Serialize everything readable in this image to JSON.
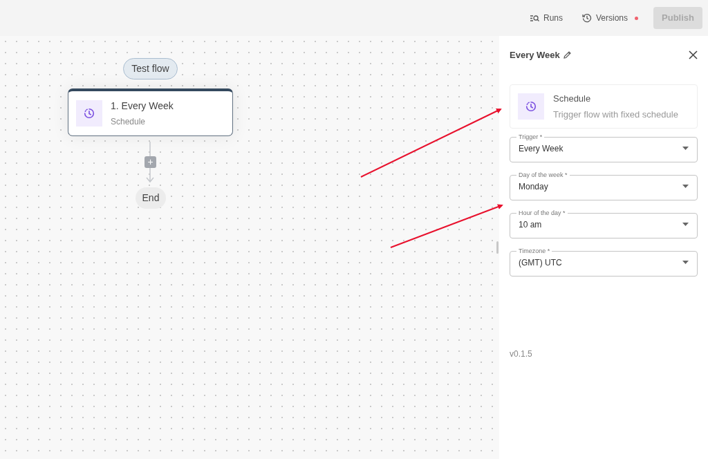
{
  "toolbar": {
    "runs": "Runs",
    "versions": "Versions",
    "versions_changed": true,
    "publish": {
      "label": "Publish",
      "disabled": true
    }
  },
  "canvas": {
    "test_button": "Test flow",
    "steps": [
      {
        "title": "1. Every Week",
        "subtitle": "Schedule"
      }
    ],
    "add_button": "+",
    "end": "End"
  },
  "panel": {
    "title": "Every Week",
    "trigger_card": {
      "title": "Schedule",
      "description": "Trigger flow with fixed schedule"
    },
    "fields": [
      {
        "label": "Trigger *",
        "value": "Every Week"
      },
      {
        "label": "Day of the week *",
        "value": "Monday"
      },
      {
        "label": "Hour of the day *",
        "value": "10 am"
      },
      {
        "label": "Timezone *",
        "value": "(GMT) UTC"
      }
    ],
    "version": "v0.1.5"
  },
  "annotations": [
    {
      "kind": "arrow"
    },
    {
      "kind": "arrow"
    }
  ]
}
